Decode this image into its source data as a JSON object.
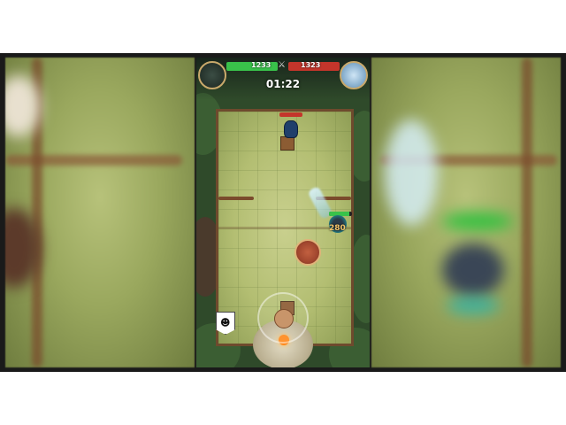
{
  "hud": {
    "left_score": "1233",
    "right_score": "1323",
    "timer": "01:22",
    "vs_symbol": "⚔"
  },
  "units": {
    "player_power": "280"
  },
  "controls": {
    "emote_icon": "face-icon",
    "joystick_icon": "joystick"
  },
  "colors": {
    "player_hp": "#39c24a",
    "enemy_hp": "#c4352b",
    "background": "#1a1a1a"
  }
}
